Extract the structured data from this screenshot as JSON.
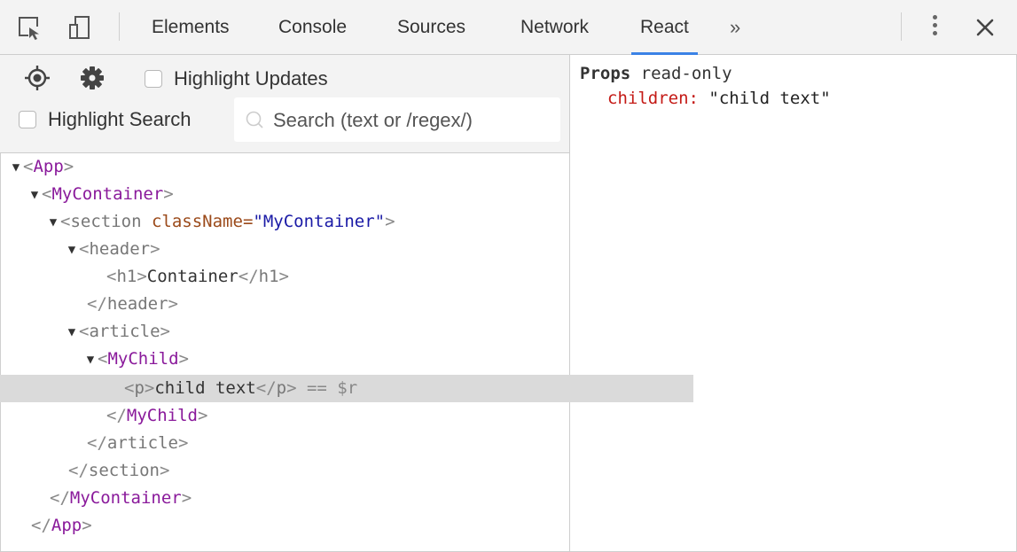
{
  "toolbar": {
    "tabs": [
      "Elements",
      "Console",
      "Sources",
      "Network",
      "React"
    ],
    "active_tab": "React",
    "more_symbol": "»",
    "icons": [
      "inspect-element-icon",
      "device-toolbar-icon",
      "more-vert-icon",
      "close-icon"
    ]
  },
  "controls": {
    "highlight_updates_label": "Highlight Updates",
    "highlight_search_label": "Highlight Search",
    "search_placeholder": "Search (text or /regex/)",
    "icons": [
      "target-icon",
      "gear-icon",
      "search-icon"
    ]
  },
  "tree": {
    "arrow": "▼",
    "app": "App",
    "my_container": "MyContainer",
    "section": "section",
    "class_attr": "className",
    "class_value": "\"MyContainer\"",
    "header": "header",
    "h1": "h1",
    "h1_text": "Container",
    "article": "article",
    "my_child": "MyChild",
    "p": "p",
    "p_text": "child text",
    "selected_marker": " == $r"
  },
  "props_panel": {
    "title": "Props",
    "subtitle": " read-only",
    "props": [
      {
        "key": "children:",
        "value": "\"child text\""
      }
    ]
  }
}
